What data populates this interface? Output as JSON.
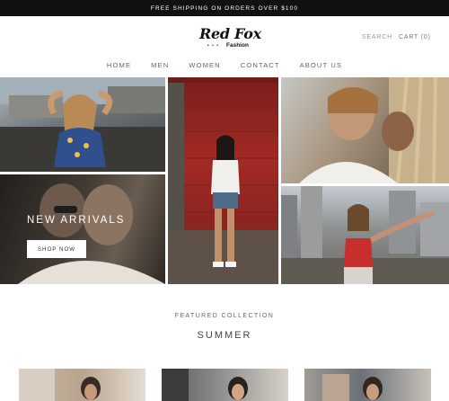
{
  "announcement": {
    "text": "FREE SHIPPING ON ORDERS OVER $100"
  },
  "header": {
    "logo": {
      "script": "Red Fox",
      "sub": "Fashion",
      "dots": "• • •"
    },
    "search_label": "SEARCH",
    "cart_label": "CART (0)"
  },
  "nav": {
    "items": [
      {
        "label": "HOME"
      },
      {
        "label": "MEN"
      },
      {
        "label": "WOMEN"
      },
      {
        "label": "CONTACT"
      },
      {
        "label": "ABOUT US"
      }
    ]
  },
  "hero": {
    "heading": "NEW ARRIVALS",
    "button_label": "SHOP NOW"
  },
  "featured": {
    "kicker": "FEATURED COLLECTION",
    "title": "SUMMER"
  },
  "colors": {
    "announcement_bg": "#111111",
    "nav_text": "#666666",
    "background": "#ffffff"
  }
}
